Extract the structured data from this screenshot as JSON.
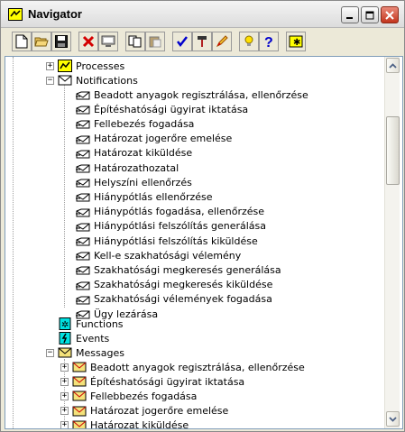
{
  "window": {
    "title": "Navigator"
  },
  "toolbar": {
    "buttons": [
      {
        "name": "new-document",
        "icon": "new-document-icon"
      },
      {
        "name": "open",
        "icon": "folder-open-icon"
      },
      {
        "name": "save",
        "icon": "floppy-disk-icon"
      },
      {
        "name": "delete",
        "icon": "red-x-icon"
      },
      {
        "name": "properties",
        "icon": "monitor-icon"
      },
      {
        "name": "copy",
        "icon": "copy-icon"
      },
      {
        "name": "paste",
        "icon": "paste-icon"
      },
      {
        "name": "check",
        "icon": "checkmark-icon"
      },
      {
        "name": "hammer",
        "icon": "hammer-icon"
      },
      {
        "name": "edit",
        "icon": "pencil-icon"
      },
      {
        "name": "hint",
        "icon": "lightbulb-icon"
      },
      {
        "name": "help",
        "icon": "question-mark-icon"
      },
      {
        "name": "function",
        "icon": "gear-star-icon"
      }
    ]
  },
  "tree": {
    "processes": "Processes",
    "notifications": "Notifications",
    "notification_items": [
      "Beadott anyagok regisztrálása, ellenőrzése",
      "Építéshatósági ügyirat iktatása",
      "Fellebezés fogadása",
      "Határozat jogerőre emelése",
      "Határozat kiküldése",
      "Határozathozatal",
      "Helyszíni ellenőrzés",
      "Hiánypótlás ellenőrzése",
      "Hiánypótlás fogadása, ellenőrzése",
      "Hiánypótlási felszólítás generálása",
      "Hiánypótlási felszólítás kiküldése",
      "Kell-e szakhatósági vélemény",
      "Szakhatósági megkeresés generálása",
      "Szakhatósági megkeresés kiküldése",
      "Szakhatósági vélemények fogadása",
      "Ügy lezárása"
    ],
    "functions": "Functions",
    "events": "Events",
    "messages": "Messages",
    "message_items": [
      "Beadott anyagok regisztrálása, ellenőrzése",
      "Építéshatósági ügyirat iktatása",
      "Fellebbezés fogadása",
      "Határozat jogerőre emelése",
      "Határozat kiküldése"
    ],
    "expand_glyph": "+",
    "collapse_glyph": "−"
  },
  "colors": {
    "accent": "#0000ff",
    "close_button": "#c3341c",
    "envelope": "#f4e27a"
  }
}
